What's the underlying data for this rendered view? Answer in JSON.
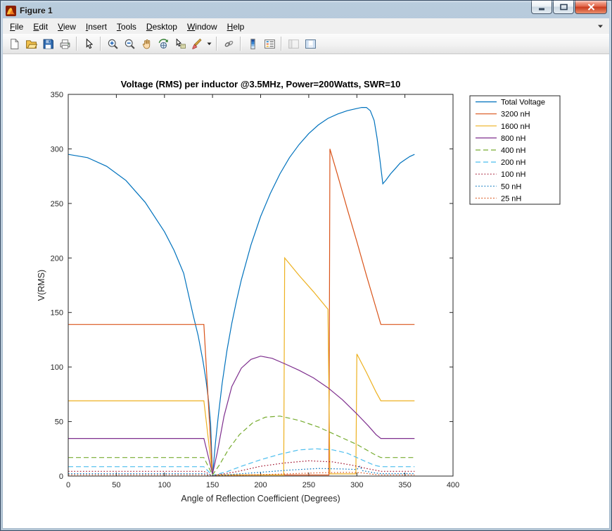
{
  "window": {
    "title": "Figure 1",
    "controls": [
      "minimize",
      "maximize",
      "close"
    ]
  },
  "menu": {
    "items": [
      "File",
      "Edit",
      "View",
      "Insert",
      "Tools",
      "Desktop",
      "Window",
      "Help"
    ]
  },
  "toolbar": {
    "buttons": [
      "new-figure",
      "open-file",
      "save-figure",
      "print-figure",
      "edit-plot",
      "zoom-in",
      "zoom-out",
      "pan",
      "rotate-3d",
      "data-cursor",
      "brush-data",
      "link-plot",
      "insert-colorbar",
      "insert-legend",
      "hide-plot-tools",
      "show-plot-tools"
    ]
  },
  "chart_data": {
    "type": "line",
    "title": "Voltage (RMS) per inductor @3.5MHz, Power=200Watts, SWR=10",
    "xlabel": "Angle of Reflection Coefficient (Degrees)",
    "ylabel": "V(RMS)",
    "xlim": [
      0,
      400
    ],
    "ylim": [
      0,
      350
    ],
    "xticks": [
      0,
      50,
      100,
      150,
      200,
      250,
      300,
      350,
      400
    ],
    "yticks": [
      0,
      50,
      100,
      150,
      200,
      250,
      300,
      350
    ],
    "grid": false,
    "legend_position": "outside-top-right",
    "series": [
      {
        "name": "Total Voltage",
        "color": "#0072BD",
        "style": "solid",
        "x": [
          0,
          20,
          40,
          60,
          80,
          100,
          110,
          120,
          130,
          135,
          140,
          143,
          146,
          148,
          150,
          153,
          156,
          160,
          165,
          170,
          175,
          180,
          190,
          200,
          210,
          220,
          230,
          240,
          250,
          260,
          270,
          280,
          290,
          300,
          305,
          310,
          314,
          318,
          321,
          324,
          327,
          330,
          335,
          340,
          345,
          350,
          355,
          360
        ],
        "y": [
          295,
          292,
          284,
          271,
          251,
          224,
          207,
          186,
          147,
          129,
          106,
          89,
          68,
          48,
          0,
          30,
          55,
          85,
          115,
          140,
          161,
          180,
          212,
          238,
          259,
          277,
          292,
          304,
          314,
          322,
          328,
          332,
          335,
          337,
          338,
          338,
          335,
          326,
          310,
          290,
          268,
          271,
          277,
          282,
          287,
          290,
          293,
          295
        ]
      },
      {
        "name": "3200 nH",
        "color": "#D95319",
        "style": "solid",
        "x": [
          0,
          141,
          150,
          270,
          271,
          272,
          280,
          290,
          300,
          310,
          320,
          325,
          360
        ],
        "y": [
          139,
          139,
          1,
          1,
          1,
          300,
          276,
          245,
          215,
          184,
          154,
          139,
          139
        ]
      },
      {
        "name": "1600 nH",
        "color": "#EDB120",
        "style": "solid",
        "x": [
          0,
          141,
          150,
          224,
          225,
          240,
          255,
          270,
          272,
          299,
          300,
          310,
          320,
          325,
          360
        ],
        "y": [
          69,
          69,
          1,
          1,
          200,
          184,
          169,
          153,
          2,
          2,
          112,
          95,
          77,
          69,
          69
        ]
      },
      {
        "name": "800 nH",
        "color": "#7E2F8E",
        "style": "solid",
        "x": [
          0,
          141,
          150,
          155,
          162,
          170,
          180,
          190,
          200,
          212,
          225,
          240,
          255,
          270,
          285,
          300,
          312,
          320,
          325,
          360
        ],
        "y": [
          34.5,
          34.5,
          2,
          22,
          55,
          82,
          99,
          107,
          110,
          108,
          103,
          97,
          90,
          81,
          70,
          57,
          46,
          38,
          34.5,
          34.5
        ]
      },
      {
        "name": "400 nH",
        "color": "#77AC30",
        "style": "dashed",
        "x": [
          0,
          141,
          150,
          157,
          167,
          178,
          192,
          205,
          220,
          240,
          260,
          280,
          300,
          312,
          320,
          325,
          360
        ],
        "y": [
          17,
          17,
          1,
          10,
          25,
          38,
          49,
          54,
          55,
          51,
          45,
          37,
          29,
          23,
          19,
          17,
          17
        ]
      },
      {
        "name": "200 nH",
        "color": "#4DBEEE",
        "style": "dashed",
        "x": [
          0,
          141,
          150,
          165,
          180,
          200,
          220,
          240,
          258,
          275,
          290,
          305,
          318,
          325,
          360
        ],
        "y": [
          8.6,
          8.6,
          0.5,
          4,
          9,
          15,
          20,
          24,
          25,
          24,
          21,
          15,
          10,
          8.6,
          8.6
        ]
      },
      {
        "name": "100 nH",
        "color": "#A2142F",
        "style": "dotted",
        "x": [
          0,
          141,
          150,
          175,
          200,
          225,
          250,
          275,
          295,
          310,
          322,
          325,
          360
        ],
        "y": [
          4.3,
          4.3,
          0.3,
          4,
          9,
          12,
          14,
          13,
          10,
          7,
          5,
          4.3,
          4.3
        ]
      },
      {
        "name": "50 nH",
        "color": "#0072BD",
        "style": "dotted",
        "x": [
          0,
          141,
          150,
          200,
          230,
          260,
          285,
          300,
          303,
          306,
          318,
          325,
          360
        ],
        "y": [
          2.2,
          2.2,
          0.2,
          3.5,
          5.5,
          7,
          6.5,
          6,
          9,
          5,
          3,
          2.2,
          2.2
        ]
      },
      {
        "name": "25 nH",
        "color": "#D95319",
        "style": "dotted",
        "x": [
          0,
          141,
          150,
          220,
          260,
          290,
          305,
          318,
          325,
          360
        ],
        "y": [
          1.1,
          1.1,
          0.1,
          1.8,
          3,
          3.5,
          3,
          1.5,
          1.1,
          1.1
        ]
      }
    ]
  }
}
